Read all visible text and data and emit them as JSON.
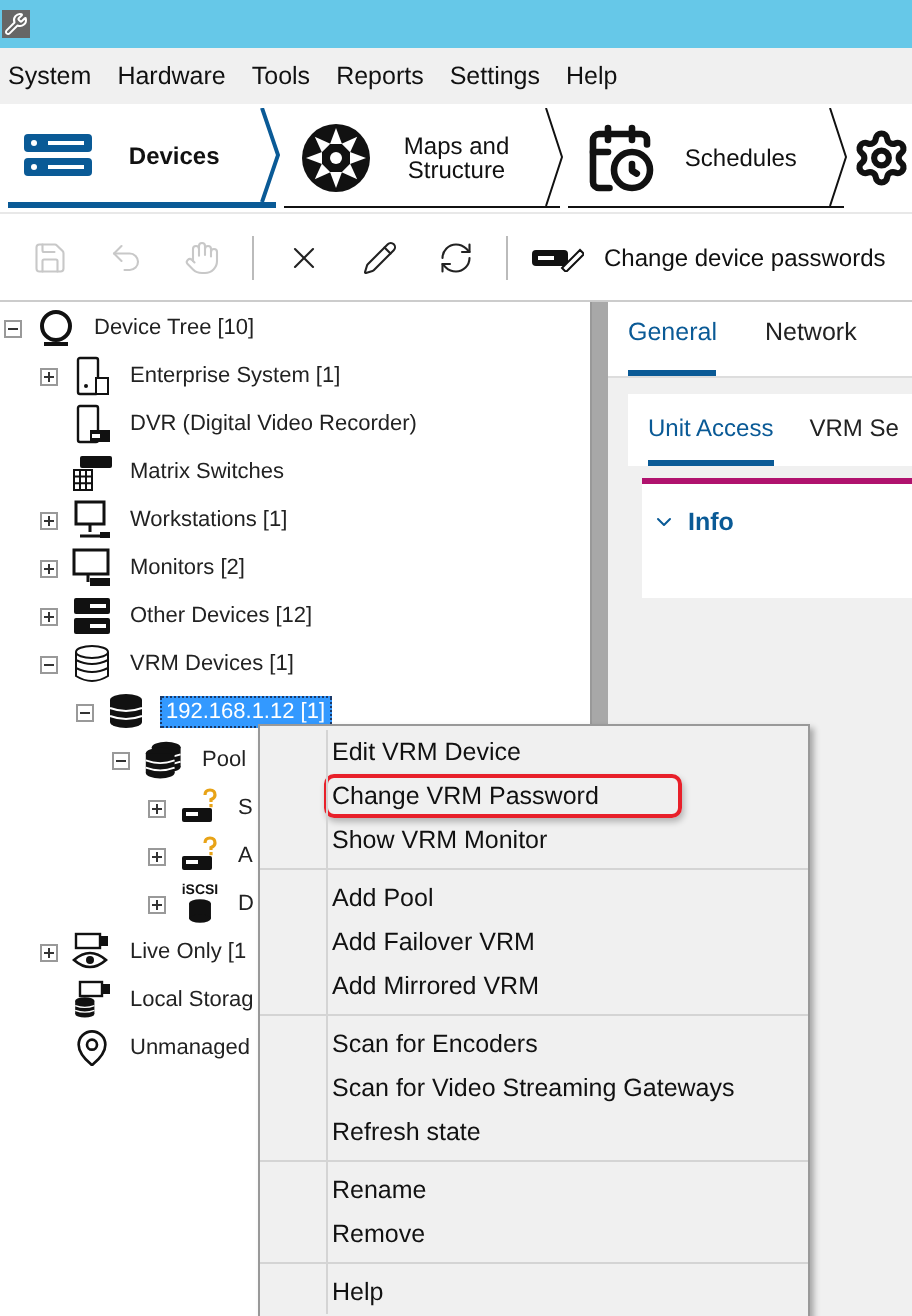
{
  "menu_bar": [
    "System",
    "Hardware",
    "Tools",
    "Reports",
    "Settings",
    "Help"
  ],
  "nav_tabs": [
    {
      "label": "Devices",
      "selected": true,
      "kind": "devices"
    },
    {
      "label": "Maps and Structure",
      "selected": false,
      "kind": "maps"
    },
    {
      "label": "Schedules",
      "selected": false,
      "kind": "schedules"
    }
  ],
  "toolbar": {
    "buttons": [
      {
        "kind": "save",
        "disabled": true
      },
      {
        "kind": "undo",
        "disabled": true
      },
      {
        "kind": "hand",
        "disabled": true
      },
      {
        "kind": "delete",
        "disabled": false
      },
      {
        "kind": "edit",
        "disabled": false
      },
      {
        "kind": "refresh",
        "disabled": false
      }
    ],
    "password_button": "Change device passwords"
  },
  "device_tree": [
    {
      "label": "Device Tree [10]",
      "kind": "root",
      "expanded": true,
      "selected": false,
      "children": [
        {
          "label": "Enterprise System [1]",
          "kind": "server-doc",
          "expanded": false,
          "selected": false
        },
        {
          "label": "DVR (Digital Video Recorder)",
          "kind": "dvr",
          "selected": false
        },
        {
          "label": "Matrix Switches",
          "kind": "matrix",
          "selected": false
        },
        {
          "label": "Workstations [1]",
          "kind": "workstation",
          "expanded": false,
          "selected": false
        },
        {
          "label": "Monitors [2]",
          "kind": "monitor",
          "expanded": false,
          "selected": false
        },
        {
          "label": "Other Devices [12]",
          "kind": "rack",
          "expanded": false,
          "selected": false
        },
        {
          "label": "VRM Devices [1]",
          "kind": "storage",
          "expanded": true,
          "selected": false,
          "children": [
            {
              "label": "192.168.1.12 [1]",
              "kind": "storage-dark",
              "expanded": true,
              "selected": true,
              "children": [
                {
                  "label": "Pool",
                  "kind": "pool",
                  "expanded": true,
                  "selected": false,
                  "children": [
                    {
                      "label": "S",
                      "kind": "device-warn",
                      "expanded": false,
                      "selected": false
                    },
                    {
                      "label": "A",
                      "kind": "device-warn",
                      "expanded": false,
                      "selected": false
                    },
                    {
                      "label": "D",
                      "kind": "iscsi",
                      "badge": "iSCSI",
                      "expanded": false,
                      "selected": false
                    }
                  ]
                }
              ]
            }
          ]
        },
        {
          "label": "Live Only [1",
          "kind": "live",
          "expanded": false,
          "selected": false
        },
        {
          "label": "Local Storag",
          "kind": "local",
          "selected": false
        },
        {
          "label": "Unmanaged",
          "kind": "pin",
          "selected": false
        }
      ]
    }
  ],
  "detail_panel": {
    "tabs": [
      {
        "label": "General",
        "selected": true
      },
      {
        "label": "Network",
        "selected": false
      }
    ],
    "sub_tabs": [
      {
        "label": "Unit Access",
        "selected": true
      },
      {
        "label": "VRM Se",
        "selected": false
      }
    ],
    "section": {
      "title": "Info",
      "expanded": true
    }
  },
  "context_menu": [
    [
      {
        "label": "Edit VRM Device",
        "outlined": false
      },
      {
        "label": "Change VRM Password",
        "outlined": true
      },
      {
        "label": "Show VRM Monitor",
        "outlined": false
      }
    ],
    [
      {
        "label": "Add Pool",
        "outlined": false
      },
      {
        "label": "Add Failover VRM",
        "outlined": false
      },
      {
        "label": "Add Mirrored VRM",
        "outlined": false
      }
    ],
    [
      {
        "label": "Scan for Encoders",
        "outlined": false
      },
      {
        "label": "Scan for Video Streaming Gateways",
        "outlined": false
      },
      {
        "label": "Refresh state",
        "outlined": false
      }
    ],
    [
      {
        "label": "Rename",
        "outlined": false
      },
      {
        "label": "Remove",
        "outlined": false
      }
    ],
    [
      {
        "label": "Help",
        "outlined": false
      }
    ]
  ]
}
